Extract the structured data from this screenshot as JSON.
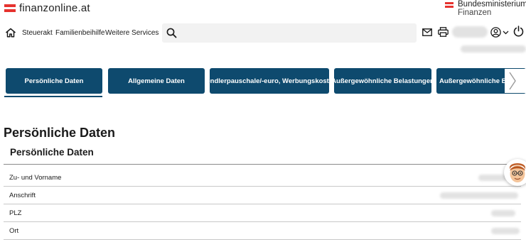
{
  "header": {
    "brand": "finanzonline.at",
    "ministry_line1": "Bundesministerium",
    "ministry_line2": "Finanzen"
  },
  "nav": {
    "home_icon": "home-icon",
    "links": [
      "Steuerakt",
      "Familienbeihilfe",
      "Weitere Services"
    ],
    "search_placeholder": "",
    "icons": [
      "search-icon",
      "mail-icon",
      "printer-icon",
      "user-circle-icon",
      "chevron-down-icon",
      "power-icon"
    ]
  },
  "tabs": {
    "items": [
      "Persönliche Daten",
      "Allgemeine Daten",
      "Pendlerpauschale/-euro, Werbungskosten",
      "Außergewöhnliche Belastungen",
      "Außergewöhnliche Belastungen"
    ],
    "active_index": 0,
    "next_icon": "chevron-right-icon"
  },
  "main": {
    "page_title": "Persönliche Daten",
    "section_title": "Persönliche Daten",
    "rows": [
      {
        "label": "Zu- und Vorname"
      },
      {
        "label": "Anschrift"
      },
      {
        "label": "PLZ"
      },
      {
        "label": "Ort"
      }
    ]
  },
  "colors": {
    "tab_bg": "#0e4a6e",
    "flag_red": "#e6322e",
    "search_bg": "#f2f2f2"
  }
}
